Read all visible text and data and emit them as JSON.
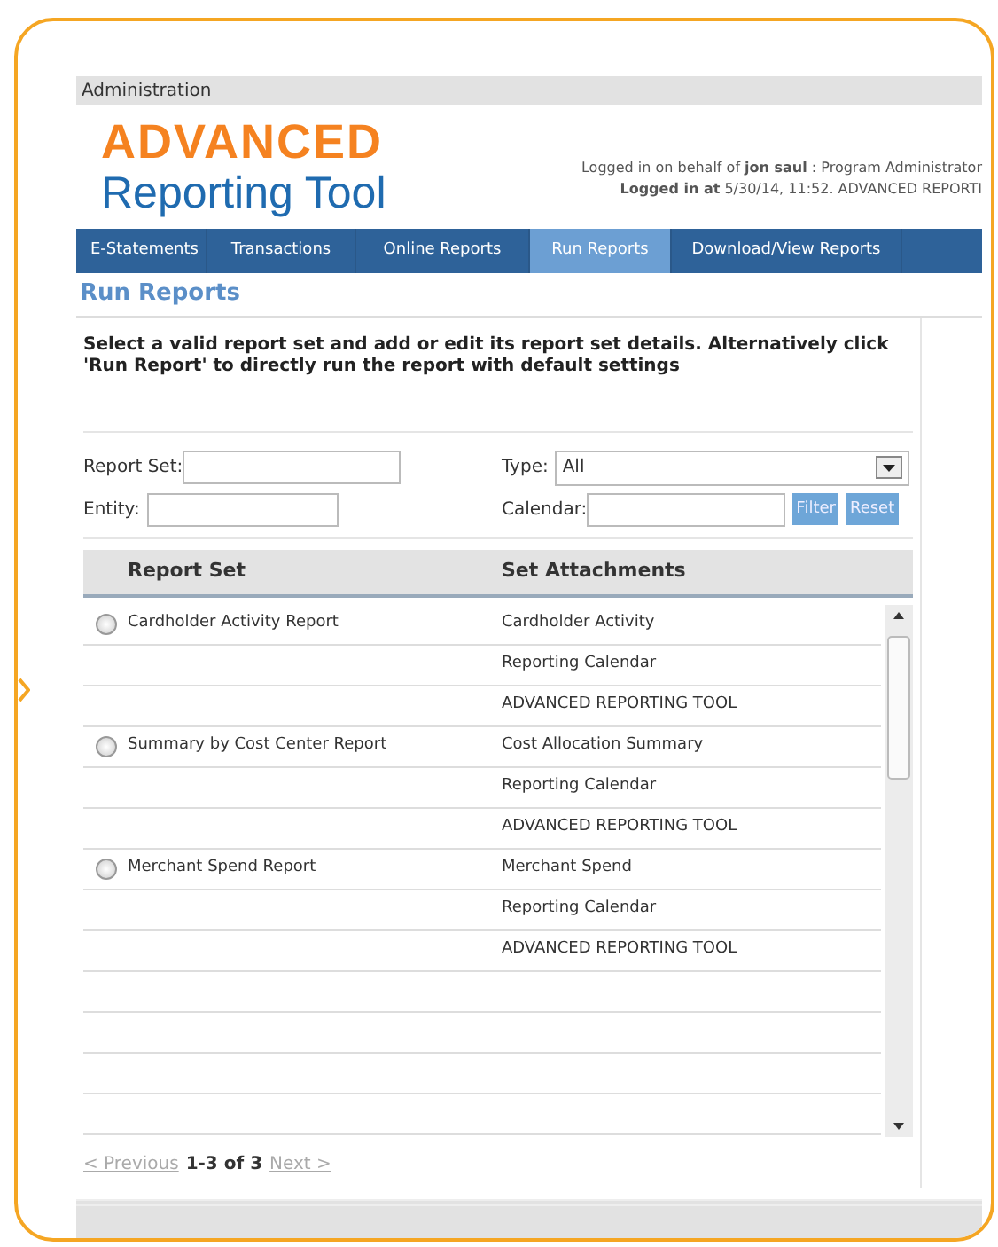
{
  "admin_bar": {
    "label": "Administration"
  },
  "logo": {
    "line_1": "ADVANCED",
    "line_2": "Reporting Tool"
  },
  "login_info": [
    "Logged in on behalf of **jon saul** : Program Administrator",
    "**Logged in at** 5/30/14, 11:52. ADVANCED REPORTI"
  ],
  "nav": [
    {
      "label": "E-Statements",
      "selected": false
    },
    {
      "label": "Transactions",
      "selected": false
    },
    {
      "label": "Online Reports",
      "selected": false
    },
    {
      "label": "Run Reports",
      "selected": true
    },
    {
      "label": "Download/View Reports",
      "selected": false
    }
  ],
  "page_title": "Run Reports",
  "instructions": "Select a valid report set and add or edit its report set details. Alternatively click 'Run Report' to directly run the report with default settings",
  "filters": {
    "report_set_label": "Report Set:",
    "type_label": "Type:",
    "type_value": "All",
    "entity_label": "Entity:",
    "calendar_label": "Calendar:",
    "buttons": [
      "Filter",
      "Reset"
    ]
  },
  "table": {
    "columns": [
      "Report Set",
      "Set Attachments"
    ],
    "groups": [
      {
        "name": "Cardholder Activity Report",
        "selected": false,
        "attachments": [
          "Cardholder Activity",
          "Reporting Calendar",
          "ADVANCED REPORTING TOOL"
        ]
      },
      {
        "name": "Summary by Cost Center Report",
        "selected": false,
        "attachments": [
          "Cost Allocation Summary",
          "Reporting Calendar",
          "ADVANCED REPORTING TOOL"
        ]
      },
      {
        "name": "Merchant Spend Report",
        "selected": false,
        "attachments": [
          "Merchant Spend",
          "Reporting Calendar",
          "ADVANCED REPORTING TOOL"
        ]
      }
    ]
  },
  "pager": {
    "previous": {
      "label": "< Previous",
      "disabled": true
    },
    "range": "1-3 of 3",
    "next": {
      "label": "Next >",
      "disabled": true
    }
  }
}
